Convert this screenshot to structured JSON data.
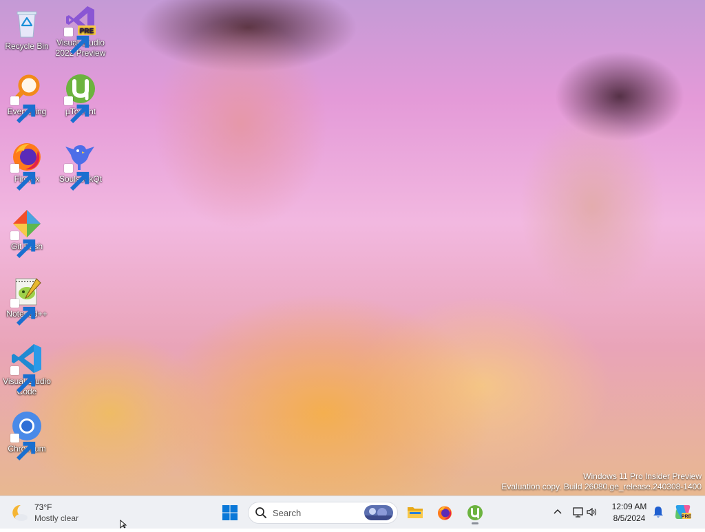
{
  "desktop": {
    "icons": [
      {
        "label": "Recycle Bin",
        "icon": "recycle-bin-icon"
      },
      {
        "label": "Visual Studio 2022 Preview",
        "icon": "visual-studio-preview-icon",
        "badge": "PRE"
      },
      {
        "label": "Everything",
        "icon": "everything-search-icon"
      },
      {
        "label": "µTorrent",
        "icon": "utorrent-icon"
      },
      {
        "label": "Firefox",
        "icon": "firefox-icon"
      },
      {
        "label": "SoulseekQt",
        "icon": "soulseek-icon"
      },
      {
        "label": "Git Bash",
        "icon": "git-bash-icon"
      },
      {
        "label": "Notepad++",
        "icon": "notepad-plus-plus-icon"
      },
      {
        "label": "Visual Studio Code",
        "icon": "vscode-icon"
      },
      {
        "label": "Chromium",
        "icon": "chromium-icon"
      }
    ],
    "watermark": {
      "line1": "Windows 11 Pro Insider Preview",
      "line2": "Evaluation copy. Build 26080.ge_release.240308-1400"
    }
  },
  "taskbar": {
    "weather": {
      "temp": "73°F",
      "condition": "Mostly clear"
    },
    "search": {
      "placeholder": "Search"
    },
    "apps": [
      {
        "name": "start",
        "icon": "windows-start-icon"
      },
      {
        "name": "file-explorer",
        "icon": "folder-icon"
      },
      {
        "name": "firefox",
        "icon": "firefox-icon"
      },
      {
        "name": "utorrent",
        "icon": "utorrent-icon",
        "running": true
      }
    ],
    "tray": {
      "time": "12:09 AM",
      "date": "8/5/2024"
    }
  },
  "colors": {
    "taskbar_bg": "#eef0f4",
    "accent_blue": "#0067c0",
    "utorrent_green": "#6cb33f"
  }
}
